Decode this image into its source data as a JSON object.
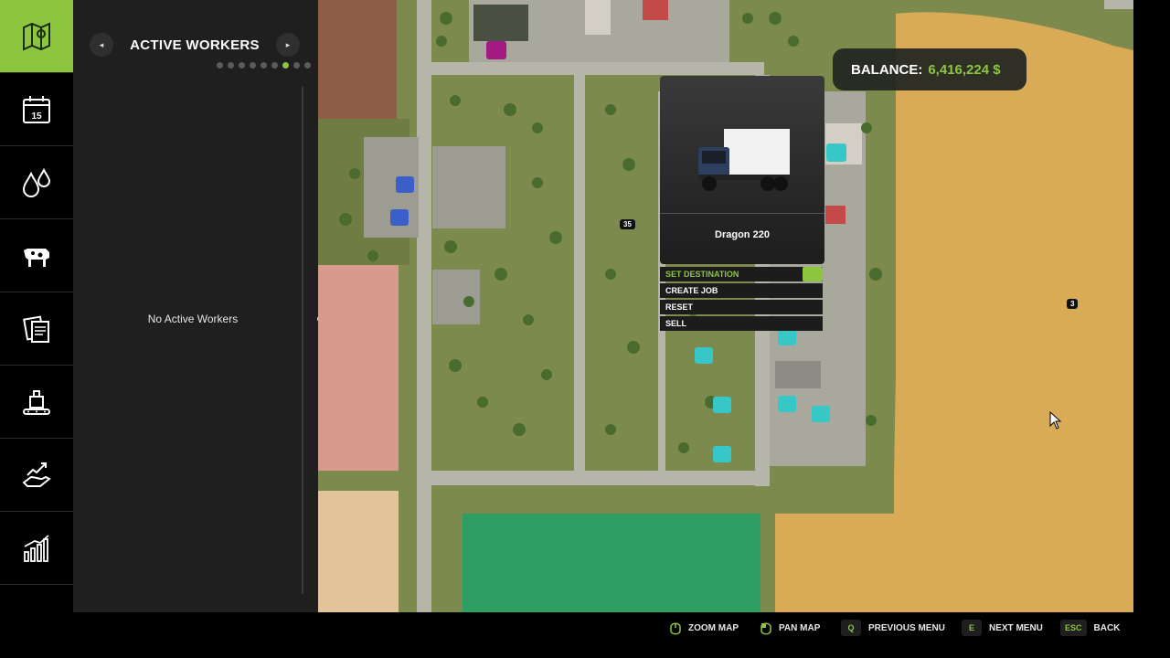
{
  "rail": {
    "items": [
      {
        "icon": "map-icon",
        "active": true
      },
      {
        "icon": "calendar-icon",
        "text": "15"
      },
      {
        "icon": "water-drops-icon"
      },
      {
        "icon": "cow-icon"
      },
      {
        "icon": "contracts-icon"
      },
      {
        "icon": "production-icon"
      },
      {
        "icon": "finance-icon"
      },
      {
        "icon": "statistics-icon"
      },
      {
        "icon": "misc-icon"
      }
    ]
  },
  "panel": {
    "title": "ACTIVE WORKERS",
    "prev_label": "◂",
    "next_label": "▸",
    "page_count": 9,
    "active_page": 7,
    "empty_message": "No Active Workers",
    "collapse_label": "▸"
  },
  "balance": {
    "label": "BALANCE:",
    "value": "6,416,224 $"
  },
  "vehicle": {
    "name": "Dragon 220",
    "menu": [
      {
        "label": "SET DESTINATION",
        "selected": true
      },
      {
        "label": "CREATE JOB",
        "selected": false
      },
      {
        "label": "RESET",
        "selected": false
      },
      {
        "label": "SELL",
        "selected": false
      }
    ]
  },
  "map": {
    "badges": [
      "35",
      "3"
    ]
  },
  "bottom": {
    "hints": [
      {
        "key": "",
        "label": "ZOOM MAP"
      },
      {
        "key": "",
        "label": "PAN MAP"
      },
      {
        "key": "Q",
        "label": "PREVIOUS MENU"
      },
      {
        "key": "E",
        "label": "NEXT MENU"
      },
      {
        "key": "ESC",
        "label": "BACK"
      }
    ]
  },
  "colors": {
    "accent": "#8cc63f",
    "panel": "#1e1f1e",
    "field_yellow": "#d9ab56",
    "field_green": "#2e9e63"
  }
}
